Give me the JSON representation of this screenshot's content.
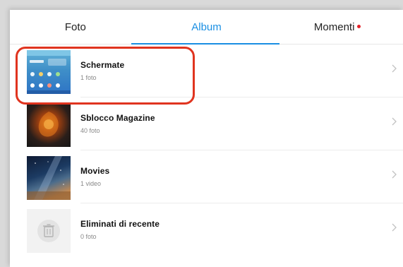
{
  "tabs": {
    "photos": "Foto",
    "albums": "Album",
    "moments": "Momenti",
    "active": "Album",
    "active_color": "#1a8fe3",
    "moments_dot_color": "#e4232a"
  },
  "albums": [
    {
      "name": "Schermate",
      "count": "1 foto",
      "thumbnail": "screenshots-thumbnail",
      "highlighted": true
    },
    {
      "name": "Sblocco Magazine",
      "count": "40 foto",
      "thumbnail": "magazine-thumbnail"
    },
    {
      "name": "Movies",
      "count": "1 video",
      "thumbnail": "movies-thumbnail"
    },
    {
      "name": "Eliminati di recente",
      "count": "0 foto",
      "thumbnail": "trash-icon"
    }
  ],
  "highlight_color": "#e0341f",
  "chevron_icon": "chevron-right-icon"
}
